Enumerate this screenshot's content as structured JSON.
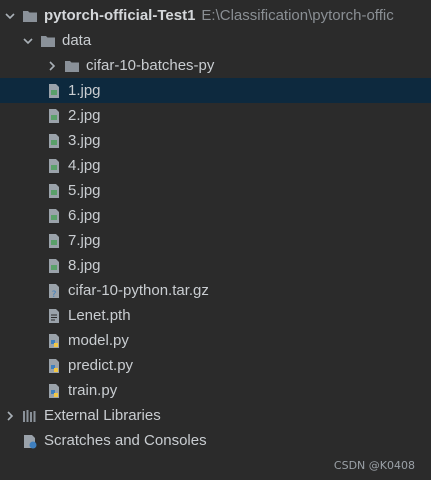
{
  "project": {
    "name": "pytorch-official-Test1",
    "path": "E:\\Classification\\pytorch-offic"
  },
  "data_folder": {
    "label": "data"
  },
  "batches_folder": {
    "label": "cifar-10-batches-py"
  },
  "files": [
    {
      "label": "1.jpg"
    },
    {
      "label": "2.jpg"
    },
    {
      "label": "3.jpg"
    },
    {
      "label": "4.jpg"
    },
    {
      "label": "5.jpg"
    },
    {
      "label": "6.jpg"
    },
    {
      "label": "7.jpg"
    },
    {
      "label": "8.jpg"
    },
    {
      "label": "cifar-10-python.tar.gz"
    }
  ],
  "project_files": [
    {
      "label": "Lenet.pth"
    },
    {
      "label": "model.py"
    },
    {
      "label": "predict.py"
    },
    {
      "label": "train.py"
    }
  ],
  "external_libraries": {
    "label": "External Libraries"
  },
  "scratches": {
    "label": "Scratches and Consoles"
  },
  "watermark": "CSDN @K0408",
  "colors": {
    "background": "#2b2b2b",
    "selection": "#0d293e",
    "folder": "#8a9199",
    "python_blue": "#3e7fbf",
    "python_yellow": "#f2c744",
    "image_green": "#5aa06a"
  },
  "icons": {
    "folder": "folder-icon",
    "image": "image-file-icon",
    "unknown": "unknown-file-icon",
    "text": "text-file-icon",
    "python": "python-file-icon",
    "libraries": "libraries-icon",
    "scratches": "scratches-icon",
    "chevron_down": "chevron-down-icon",
    "chevron_right": "chevron-right-icon"
  }
}
